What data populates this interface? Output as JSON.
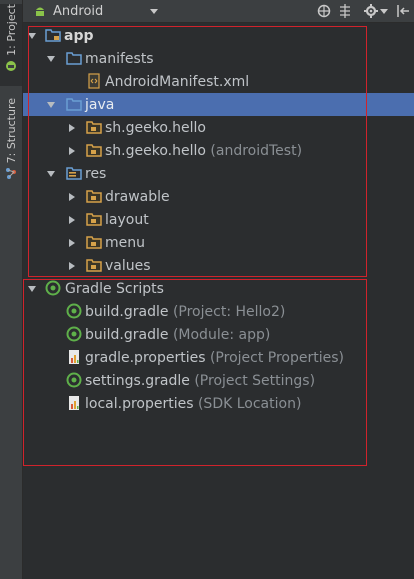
{
  "sidebar": {
    "project_tab": "1: Project",
    "structure_tab": "7: Structure"
  },
  "toolbar": {
    "view_mode": "Android",
    "icons": [
      "android-icon",
      "chevron-down-icon",
      "scroll-from-source-icon",
      "collapse-all-icon",
      "settings-icon",
      "hide-icon"
    ]
  },
  "tree": {
    "app": "app",
    "manifests": "manifests",
    "manifest_file": "AndroidManifest.xml",
    "java": "java",
    "pkg1": "sh.geeko.hello",
    "pkg2": "sh.geeko.hello",
    "pkg2_hint": "(androidTest)",
    "res": "res",
    "drawable": "drawable",
    "layout": "layout",
    "menu": "menu",
    "values": "values",
    "gradle_scripts": "Gradle Scripts",
    "g1": "build.gradle",
    "g1_hint": "(Project: Hello2)",
    "g2": "build.gradle",
    "g2_hint": "(Module: app)",
    "g3": "gradle.properties",
    "g3_hint": "(Project Properties)",
    "g4": "settings.gradle",
    "g4_hint": "(Project Settings)",
    "g5": "local.properties",
    "g5_hint": "(SDK Location)"
  },
  "colors": {
    "background": "#2b2d2f",
    "selection": "#4b6eaf",
    "highlight_box": "#d0232c",
    "folder_blue": "#6a9ed3",
    "folder_orange": "#d6a24a"
  }
}
